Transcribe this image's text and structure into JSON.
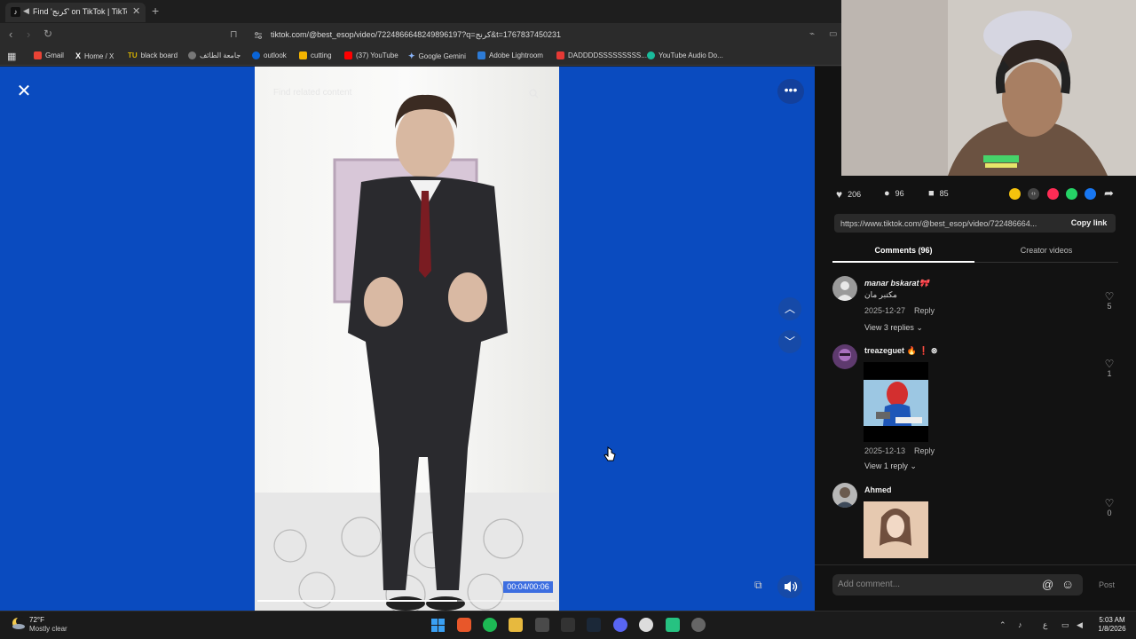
{
  "browser": {
    "tab_title": "Find 'كرنج' on TikTok | TikTok S",
    "tab_favicon": "tiktok-icon",
    "url": "tiktok.com/@best_esop/video/7224866648249896197?q=كرنج&t=1767837450231",
    "bookmarks": [
      {
        "label": "Gmail",
        "color": "#ea4335"
      },
      {
        "label": "Home / X",
        "color": "#ffffff"
      },
      {
        "label": "black board",
        "color": "#d9b400",
        "prefix": "TU"
      },
      {
        "label": "جامعة الطائف",
        "color": "#888888"
      },
      {
        "label": "outlook",
        "color": "#0a64d6"
      },
      {
        "label": "cutting",
        "color": "#e91e63"
      },
      {
        "label": "(37) YouTube",
        "color": "#ff0000"
      },
      {
        "label": "Google Gemini",
        "color": "#8ab4f8"
      },
      {
        "label": "Adobe Lightroom",
        "color": "#2d7bd6"
      },
      {
        "label": "DADDDDSSSSSSSSS...",
        "color": "#e53935"
      },
      {
        "label": "YouTube Audio Do...",
        "color": "#1abc9c"
      }
    ]
  },
  "viewer": {
    "search_placeholder": "Find related content",
    "time_display": "00:04/00:06",
    "progress": 0.67
  },
  "panel": {
    "likes": "206",
    "comments": "96",
    "saves": "85",
    "share_colors": [
      "#f4c20d",
      "#555555",
      "#fe2c55",
      "#25d366",
      "#1877f2"
    ],
    "link": "https://www.tiktok.com/@best_esop/video/722486664...",
    "copy_label": "Copy link",
    "tab_comments": "Comments (96)",
    "tab_creator": "Creator videos",
    "comments_list": [
      {
        "name": "manar bskarat🎀",
        "text": "مكتبر مان",
        "date": "2025-12-27",
        "reply": "Reply",
        "views": "View 3 replies",
        "likes": "5"
      },
      {
        "name": "treazeguet 🔥 ❗ ⊗",
        "date": "2025-12-13",
        "reply": "Reply",
        "views": "View 1 reply",
        "likes": "1"
      },
      {
        "name": "Ahmed",
        "likes": "0"
      }
    ],
    "add_placeholder": "Add comment...",
    "post_label": "Post"
  },
  "taskbar": {
    "temp": "72°F",
    "weather": "Mostly clear",
    "time": "5:03 AM",
    "date": "1/8/2026",
    "lang": "ع"
  }
}
